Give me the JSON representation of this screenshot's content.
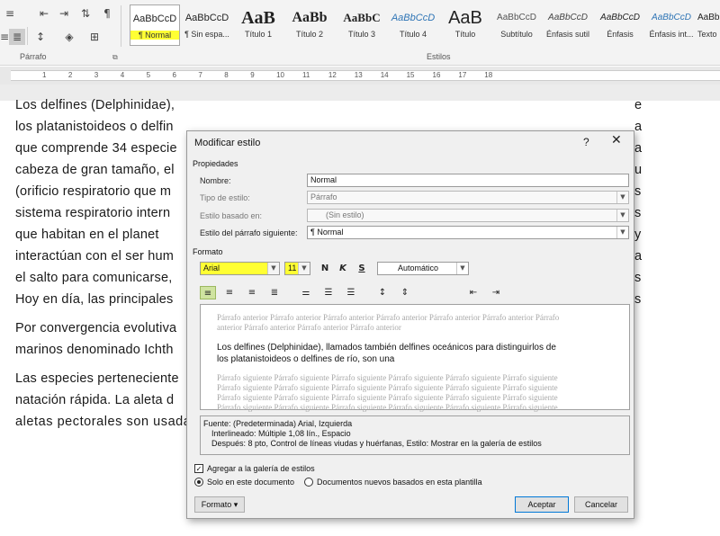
{
  "ribbon": {
    "paragraph_group_label": "Párrafo",
    "styles_group_label": "Estilos",
    "styles": [
      {
        "sample": "AaBbCcD",
        "name": "¶ Normal",
        "selected": true
      },
      {
        "sample": "AaBbCcD",
        "name": "¶ Sin espa..."
      },
      {
        "sample": "AaB",
        "name": "Título 1"
      },
      {
        "sample": "AaBb",
        "name": "Título 2"
      },
      {
        "sample": "AaBbC",
        "name": "Título 3"
      },
      {
        "sample": "AaBbCcD",
        "name": "Título 4"
      },
      {
        "sample": "AaB",
        "name": "Título"
      },
      {
        "sample": "AaBbCcD",
        "name": "Subtítulo"
      },
      {
        "sample": "AaBbCcD",
        "name": "Énfasis sutil"
      },
      {
        "sample": "AaBbCcD",
        "name": "Énfasis"
      },
      {
        "sample": "AaBbCcD",
        "name": "Énfasis int..."
      },
      {
        "sample": "AaBbCcD",
        "name": "Texto"
      }
    ]
  },
  "ruler": {
    "labels": [
      "1",
      "2",
      "3",
      "4",
      "5",
      "6",
      "7",
      "8",
      "9",
      "10",
      "11",
      "12",
      "13",
      "14",
      "15",
      "16",
      "17",
      "18"
    ]
  },
  "document": {
    "lines": [
      "Los delfines (Delphinidae),",
      "los platanistoideos o delfin",
      "que comprende 34 especie",
      "cabeza de gran tamaño, el",
      "(orificio respiratorio que m",
      "sistema respiratorio intern",
      "que habitan en el planet",
      "interactúan con el ser hum",
      "el salto para comunicarse,",
      "Hoy en día, las principales",
      "Por convergencia evolutiva",
      "marinos denominado Ichth",
      "Las especies perteneciente",
      "natación rápida. La aleta d",
      "aletas pectorales son usadas para el control direccional del nado. Los patrones básicos de"
    ],
    "right_edge_chars": [
      "e",
      "a",
      "a",
      "u",
      "s",
      "s",
      "y",
      "a",
      "s",
      "s"
    ]
  },
  "dialog": {
    "title": "Modificar estilo",
    "help": "?",
    "close": "✕",
    "properties_heading": "Propiedades",
    "name_label": "Nombre:",
    "name_value": "Normal",
    "type_label": "Tipo de estilo:",
    "type_value": "Párrafo",
    "based_label": "Estilo basado en:",
    "based_value": "(Sin estilo)",
    "next_label": "Estilo del párrafo siguiente:",
    "next_value": "¶  Normal",
    "format_heading": "Formato",
    "font": "Arial",
    "size": "11",
    "bold": "N",
    "italic": "K",
    "underline": "S",
    "color": "Automático",
    "preview": {
      "prev_lines": [
        "Párrafo anterior Párrafo anterior Párrafo anterior Párrafo anterior Párrafo anterior Párrafo anterior Párrafo",
        "anterior Párrafo anterior Párrafo anterior Párrafo anterior"
      ],
      "main_lines": [
        "Los delfines (Delphinidae), llamados también delfines oceánicos para distinguirlos de",
        "los platanistoideos o delfines de río, son una"
      ],
      "next_lines": [
        "Párrafo siguiente Párrafo siguiente Párrafo siguiente Párrafo siguiente Párrafo siguiente Párrafo siguiente",
        "Párrafo siguiente Párrafo siguiente Párrafo siguiente Párrafo siguiente Párrafo siguiente Párrafo siguiente",
        "Párrafo siguiente Párrafo siguiente Párrafo siguiente Párrafo siguiente Párrafo siguiente Párrafo siguiente",
        "Párrafo siguiente Párrafo siguiente Párrafo siguiente Párrafo siguiente Párrafo siguiente Párrafo siguiente"
      ]
    },
    "description": [
      "Fuente: (Predeterminada) Arial, Izquierda",
      "Interlineado:  Múltiple 1,08 lín., Espacio",
      "Después:  8 pto, Control de líneas viudas y huérfanas, Estilo: Mostrar en la galería de estilos"
    ],
    "add_to_gallery": "Agregar a la galería de estilos",
    "only_this_doc": "Solo en este documento",
    "new_docs": "Documentos nuevos basados en esta plantilla",
    "format_button": "Formato ▾",
    "ok": "Aceptar",
    "cancel": "Cancelar"
  },
  "colors": {
    "highlight": "#ffff33",
    "accent_border": "#0078d7"
  }
}
